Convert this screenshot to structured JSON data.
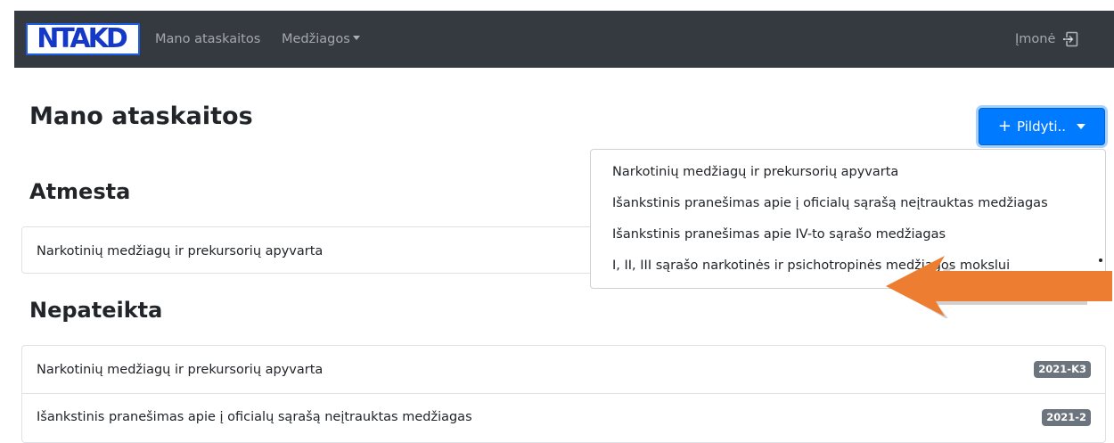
{
  "navbar": {
    "logo_text": "NTAKD",
    "links": {
      "my_reports": "Mano ataskaitos",
      "substances": "Medžiagos"
    },
    "company": "Įmonė"
  },
  "page": {
    "title": "Mano ataskaitos",
    "fill_button": {
      "plus": "+",
      "label": "Pildyti.."
    }
  },
  "dropdown": {
    "items": [
      "Narkotinių medžiagų ir prekursorių apyvarta",
      "Išankstinis pranešimas apie į oficialų sąrašą neįtrauktas medžiagas",
      "Išankstinis pranešimas apie IV-to sąrašo medžiagas",
      "I, II, III sąrašo narkotinės ir psichotropinės medžiagos mokslui"
    ]
  },
  "sections": {
    "rejected": {
      "heading": "Atmesta",
      "items": [
        {
          "label": "Narkotinių medžiagų ir prekursorių apyvarta"
        }
      ]
    },
    "not_submitted": {
      "heading": "Nepateikta",
      "items": [
        {
          "label": "Narkotinių medžiagų ir prekursorių apyvarta",
          "badge": "2021-K3"
        },
        {
          "label": "Išankstinis pranešimas apie į oficialų sąrašą neįtrauktas medžiagas",
          "badge": "2021-2"
        }
      ]
    }
  },
  "colors": {
    "navbar_bg": "#343a40",
    "primary": "#007bff",
    "badge_bg": "#6c757d",
    "arrow_fill": "#ed7d31"
  },
  "icons": {
    "logout": "logout-icon",
    "caret": "chevron-down-icon",
    "annotation": "arrow-left-icon"
  }
}
